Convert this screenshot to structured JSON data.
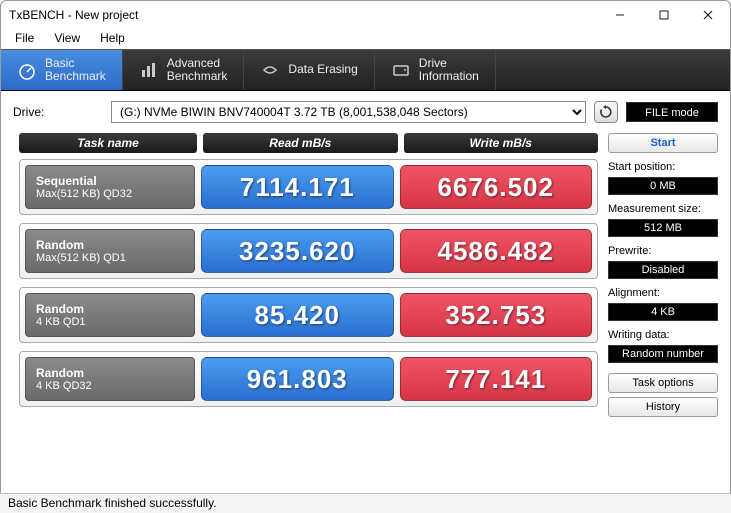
{
  "window": {
    "title": "TxBENCH - New project"
  },
  "menu": {
    "file": "File",
    "view": "View",
    "help": "Help"
  },
  "tabs": {
    "basic": "Basic\nBenchmark",
    "advanced": "Advanced\nBenchmark",
    "erase": "Data Erasing",
    "drive": "Drive\nInformation"
  },
  "drive": {
    "label": "Drive:",
    "selected": "(G:) NVMe BIWIN BNV740004T  3.72 TB (8,001,538,048 Sectors)",
    "filemode": "FILE mode"
  },
  "headers": {
    "task": "Task name",
    "read": "Read mB/s",
    "write": "Write mB/s"
  },
  "rows": [
    {
      "t1": "Sequential",
      "t2": "Max(512 KB) QD32",
      "read": "7114.171",
      "write": "6676.502"
    },
    {
      "t1": "Random",
      "t2": "Max(512 KB) QD1",
      "read": "3235.620",
      "write": "4586.482"
    },
    {
      "t1": "Random",
      "t2": "4 KB QD1",
      "read": "85.420",
      "write": "352.753"
    },
    {
      "t1": "Random",
      "t2": "4 KB QD32",
      "read": "961.803",
      "write": "777.141"
    }
  ],
  "side": {
    "start": "Start",
    "startpos_l": "Start position:",
    "startpos_v": "0 MB",
    "msize_l": "Measurement size:",
    "msize_v": "512 MB",
    "prewrite_l": "Prewrite:",
    "prewrite_v": "Disabled",
    "align_l": "Alignment:",
    "align_v": "4 KB",
    "wdata_l": "Writing data:",
    "wdata_v": "Random number",
    "taskopt": "Task options",
    "history": "History"
  },
  "status": "Basic Benchmark finished successfully.",
  "chart_data": {
    "type": "table",
    "title": "TxBENCH Basic Benchmark",
    "columns": [
      "Task name",
      "Read mB/s",
      "Write mB/s"
    ],
    "rows": [
      [
        "Sequential Max(512 KB) QD32",
        7114.171,
        6676.502
      ],
      [
        "Random Max(512 KB) QD1",
        3235.62,
        4586.482
      ],
      [
        "Random 4 KB QD1",
        85.42,
        352.753
      ],
      [
        "Random 4 KB QD32",
        961.803,
        777.141
      ]
    ]
  }
}
